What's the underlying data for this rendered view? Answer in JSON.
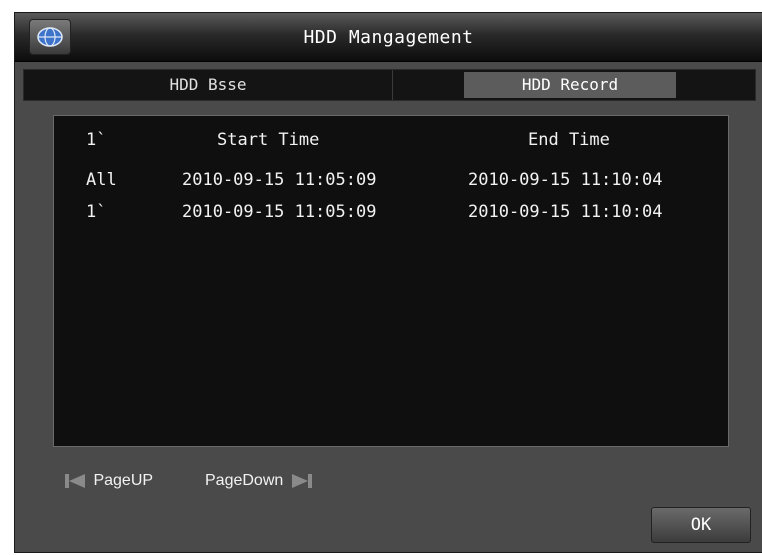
{
  "window": {
    "title": "HDD Mangagement"
  },
  "tabs": [
    {
      "label": "HDD Bsse",
      "active": false
    },
    {
      "label": "HDD Record",
      "active": true
    }
  ],
  "records": {
    "header": {
      "channel": "1`",
      "start": "Start Time",
      "end": "End Time"
    },
    "rows": [
      {
        "channel": "All",
        "start": "2010-09-15 11:05:09",
        "end": "2010-09-15 11:10:04"
      },
      {
        "channel": "1`",
        "start": "2010-09-15 11:05:09",
        "end": "2010-09-15 11:10:04"
      }
    ]
  },
  "pager": {
    "page_up": "PageUP",
    "page_down": "PageDown"
  },
  "buttons": {
    "ok": "OK"
  },
  "icons": {
    "logo": "globe-icon",
    "prev": "skip-previous-icon",
    "next": "skip-next-icon"
  }
}
